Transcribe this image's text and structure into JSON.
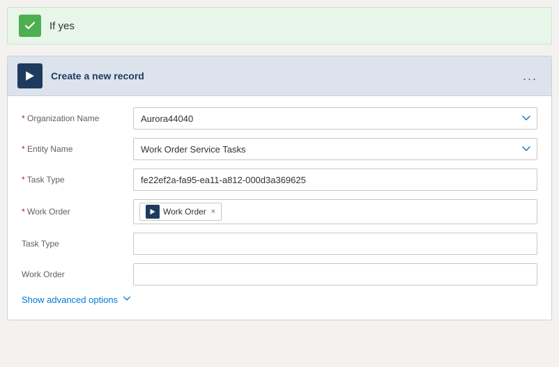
{
  "ifyes": {
    "label": "If yes"
  },
  "card": {
    "title": "Create a new record",
    "menu_label": "...",
    "fields": [
      {
        "id": "org-name",
        "label": "Organization Name",
        "required": true,
        "type": "dropdown",
        "value": "Aurora44040"
      },
      {
        "id": "entity-name",
        "label": "Entity Name",
        "required": true,
        "type": "dropdown",
        "value": "Work Order Service Tasks"
      },
      {
        "id": "task-type-required",
        "label": "Task Type",
        "required": true,
        "type": "text",
        "value": "fe22ef2a-fa95-ea11-a812-000d3a369625"
      },
      {
        "id": "work-order-required",
        "label": "Work Order",
        "required": true,
        "type": "tag",
        "tag_label": "Work Order"
      },
      {
        "id": "task-type-optional",
        "label": "Task Type",
        "required": false,
        "type": "text",
        "value": ""
      },
      {
        "id": "work-order-optional",
        "label": "Work Order",
        "required": false,
        "type": "text",
        "value": ""
      }
    ],
    "advanced": {
      "label": "Show advanced options"
    }
  }
}
